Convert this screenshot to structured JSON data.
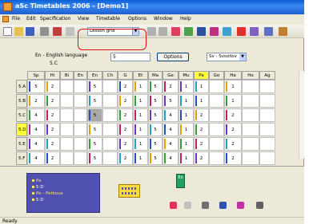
{
  "window": {
    "title": "aSc Timetables 2006 - [Demo1]"
  },
  "menu": [
    "File",
    "Edit",
    "Specification",
    "View",
    "Timetable",
    "Options",
    "Window",
    "Help"
  ],
  "toolbar": {
    "view_combo": "Lesson grid"
  },
  "header": {
    "language": "En - English language",
    "class_label": "5.C",
    "class_input": "5",
    "options_button": "Options",
    "teacher_select": "Sv - Svozilov"
  },
  "grid": {
    "columns": [
      "Sp",
      "Hi",
      "Bi",
      "En",
      "En",
      "Ch",
      "G",
      "Et",
      "Ma",
      "Ge",
      "Mu",
      "Pa",
      "Go",
      "Ha",
      "Ho",
      "Ag"
    ],
    "highlight_column": "Pa",
    "rows": [
      {
        "label": "5.A",
        "cells": [
          "5",
          "2",
          "",
          "",
          "5",
          "",
          "2",
          "1",
          "5",
          "2",
          "1",
          "1",
          "",
          "1",
          "",
          ""
        ]
      },
      {
        "label": "5.B",
        "cells": [
          "2",
          "2",
          "",
          "",
          "5",
          "",
          "2",
          "1",
          "5",
          "5",
          "1",
          "1",
          "",
          "1",
          "",
          ""
        ]
      },
      {
        "label": "5.C",
        "cells": [
          "4",
          "2",
          "",
          "",
          "5",
          "",
          "2",
          "1",
          "5",
          "4",
          "1",
          "2",
          "",
          "2",
          "",
          ""
        ]
      },
      {
        "label": "5.D",
        "cells": [
          "4",
          "2",
          "",
          "",
          "5",
          "",
          "2",
          "1",
          "5",
          "4",
          "1",
          "2",
          "",
          "2",
          "",
          ""
        ]
      },
      {
        "label": "5.E",
        "cells": [
          "4",
          "2",
          "",
          "",
          "5",
          "",
          "2",
          "1",
          "5",
          "4",
          "1",
          "2",
          "",
          "2",
          "",
          ""
        ]
      },
      {
        "label": "5.F",
        "cells": [
          "4",
          "2",
          "",
          "",
          "5",
          "",
          "2",
          "1",
          "5",
          "4",
          "1",
          "2",
          "",
          "2",
          "",
          ""
        ]
      }
    ],
    "highlight_row": "5.D"
  },
  "legend": {
    "items": [
      {
        "text": "Pa"
      },
      {
        "text": "5.D"
      },
      {
        "text": "Pe - Petkova"
      },
      {
        "text": "5.D"
      }
    ]
  },
  "card": {
    "label": "En"
  },
  "status": {
    "text": "Ready"
  },
  "colors": {
    "titlebar": "#0a5fd6",
    "highlight": "#ffff40",
    "legend_bg": "#5050b0",
    "accent_red": "#e01010"
  }
}
